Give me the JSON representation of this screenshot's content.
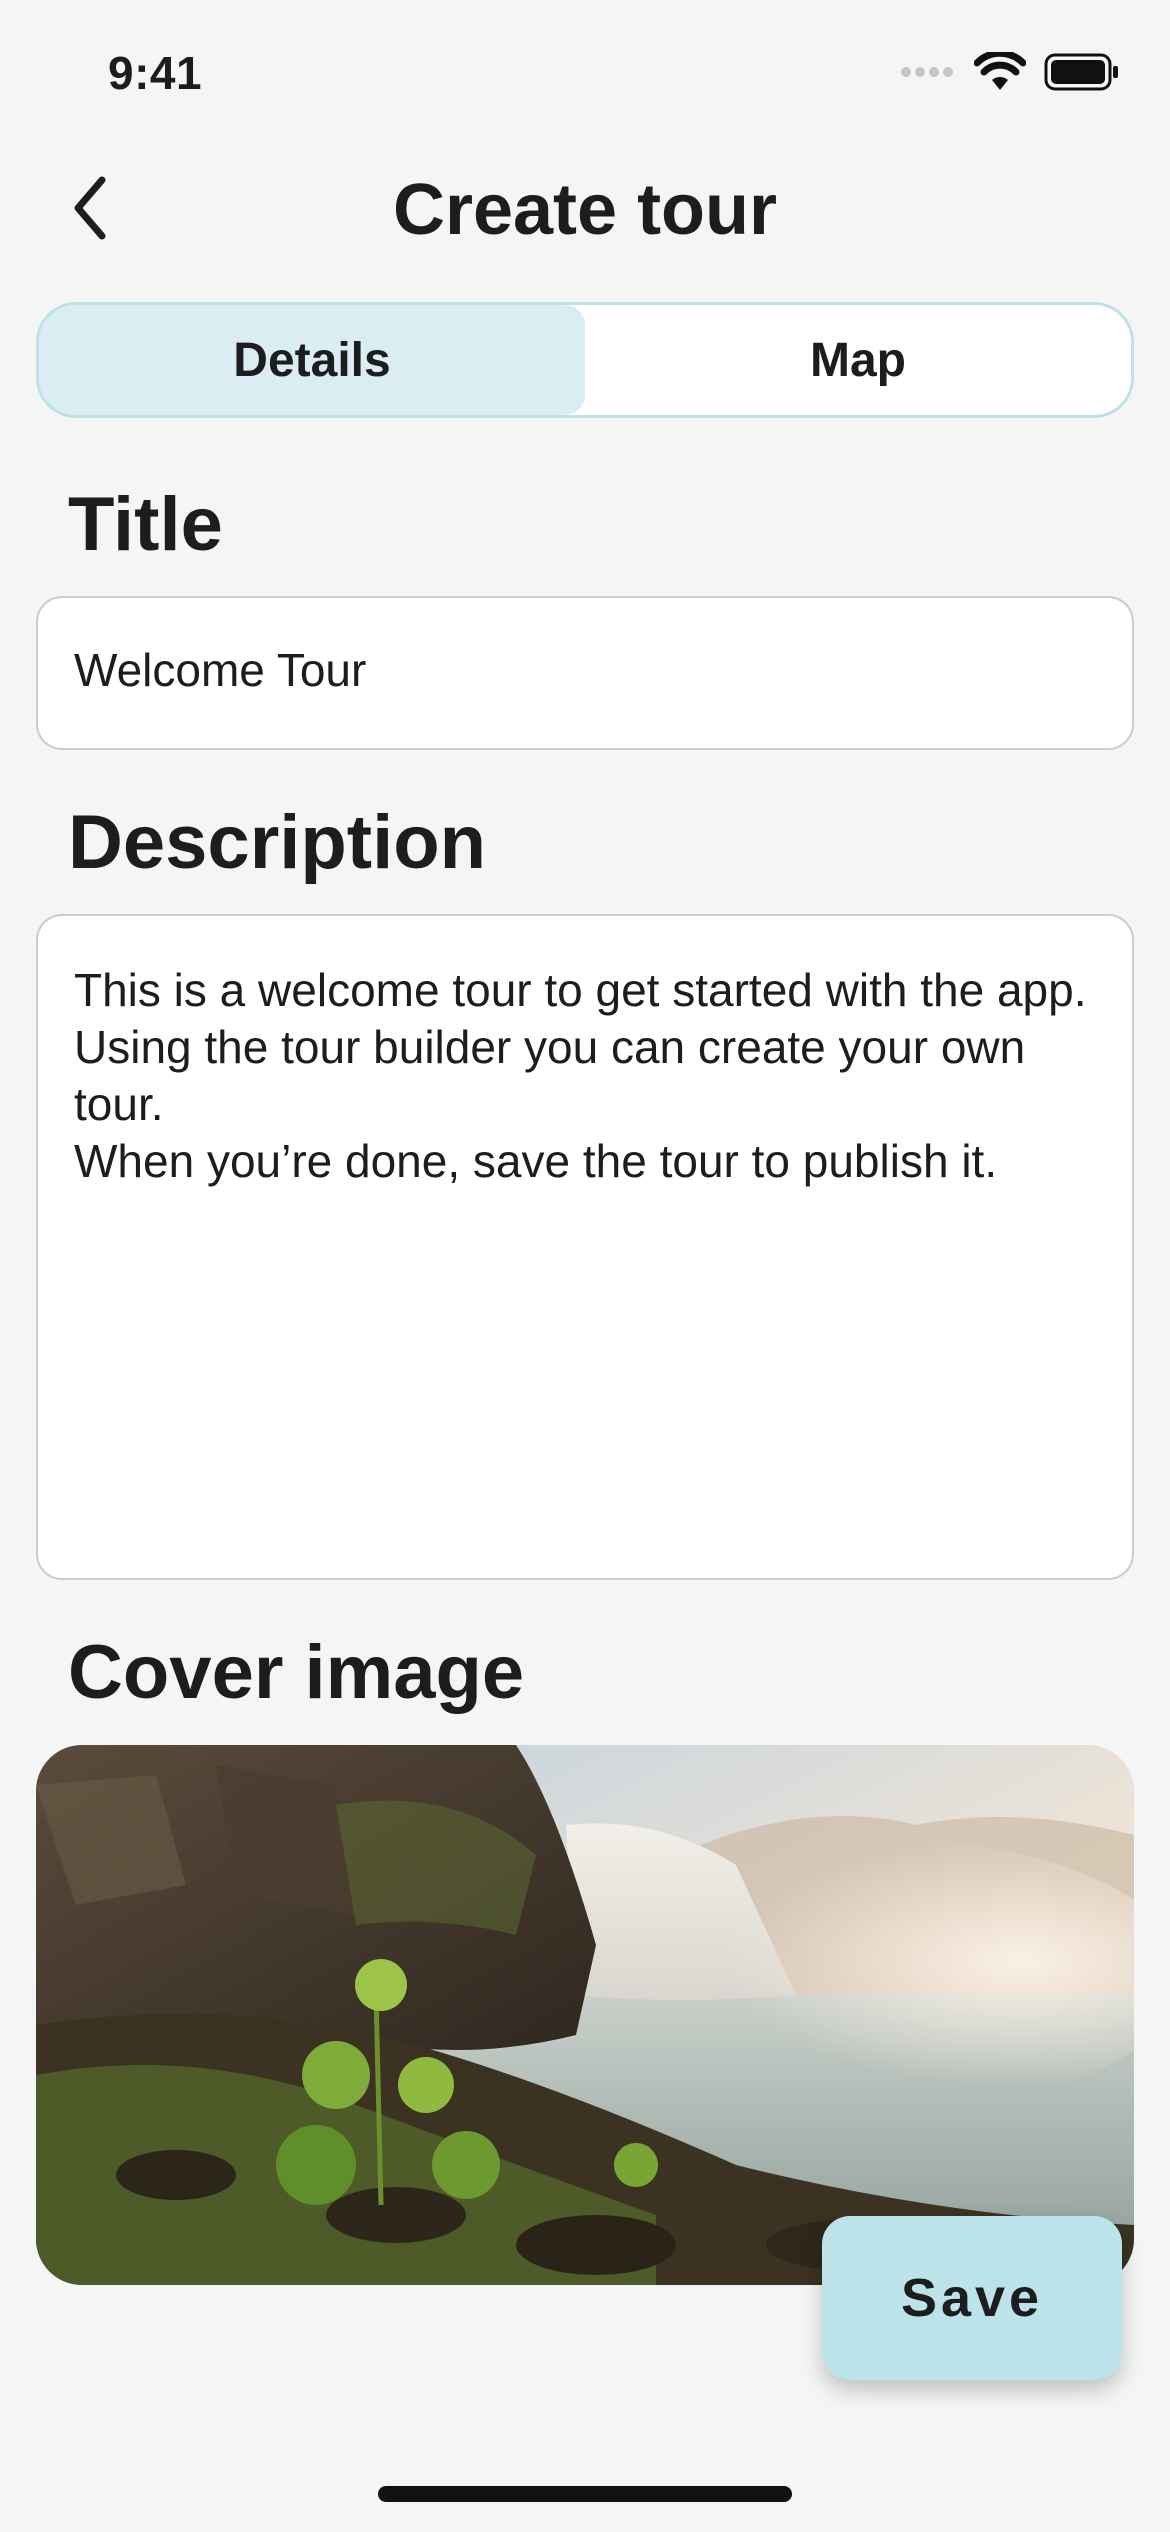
{
  "status_bar": {
    "time": "9:41"
  },
  "nav": {
    "title": "Create tour"
  },
  "tabs": [
    {
      "label": "Details",
      "active": true
    },
    {
      "label": "Map",
      "active": false
    }
  ],
  "form": {
    "title_label": "Title",
    "title_value": "Welcome Tour",
    "description_label": "Description",
    "description_value": "This is a welcome tour to get started with the app.\nUsing the tour builder you can create your own tour.\nWhen you’re done, save the tour to publish it.",
    "cover_label": "Cover image"
  },
  "actions": {
    "save_label": "Save"
  },
  "colors": {
    "background": "#f4f6f6",
    "accent": "#d9edf3",
    "save_button": "#bde3ea"
  }
}
